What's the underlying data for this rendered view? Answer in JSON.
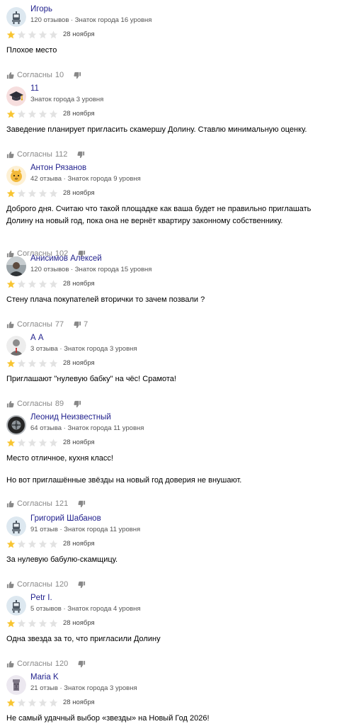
{
  "colors": {
    "star_filled": "#f8c531",
    "star_empty": "#e2e2e2",
    "author_link": "#23238e",
    "meta": "#555555",
    "reaction": "#888888"
  },
  "reviews": [
    {
      "author": "Игорь",
      "meta": "120 отзывов · Знаток города 16 уровня",
      "avatar": "robot-icon",
      "rating": 1,
      "date": "28 ноября",
      "text": [
        "Плохое место"
      ],
      "agree_label": "Согласны",
      "likes": "10",
      "dislikes": ""
    },
    {
      "author": "11",
      "meta": "Знаток города 3 уровня",
      "avatar": "graduation-cap-icon",
      "rating": 1,
      "date": "28 ноября",
      "text": [
        "Заведение планирует пригласить скамершу Долину. Ставлю минимальную оценку."
      ],
      "agree_label": "Согласны",
      "likes": "112",
      "dislikes": ""
    },
    {
      "author": "Антон Рязанов",
      "meta": "42 отзыва · Знаток города 9 уровня",
      "avatar": "cat-face-icon",
      "rating": 1,
      "date": "28 ноября",
      "text": [
        "Доброго дня. Считаю что такой площадке как ваша будет не правильно приглашать Долину на новый год, пока она не вернёт квартиру законному собственнику."
      ],
      "agree_label": "Согласны",
      "likes": "102",
      "dislikes": ""
    },
    {
      "author": "Анисимов Алексей",
      "meta": "120 отзывов · Знаток города 15 уровня",
      "avatar": "user-photo-avatar",
      "rating": 1,
      "date": "28 ноября",
      "text": [
        "Стену плача покупателей вторички то зачем позвали ?"
      ],
      "agree_label": "Согласны",
      "likes": "77",
      "dislikes": "7"
    },
    {
      "author": "А А",
      "meta": "3 отзыва · Знаток города 3 уровня",
      "avatar": "person-silhouette-icon",
      "rating": 1,
      "date": "28 ноября",
      "text": [
        "Приглашают \"нулевую бабку\" на чёс! Срамота!"
      ],
      "agree_label": "Согласны",
      "likes": "89",
      "dislikes": ""
    },
    {
      "author": "Леонид Неизвестный",
      "meta": "64 отзыва · Знаток города 11 уровня",
      "avatar": "tire-photo-avatar",
      "rating": 1,
      "date": "28 ноября",
      "text": [
        "Место отличное, кухня класс!",
        "Но вот приглашённые звёзды на новый год доверия не внушают."
      ],
      "agree_label": "Согласны",
      "likes": "121",
      "dislikes": ""
    },
    {
      "author": "Григорий Шабанов",
      "meta": "91 отзыв · Знаток города 11 уровня",
      "avatar": "robot-icon",
      "rating": 1,
      "date": "28 ноября",
      "text": [
        "За нулевую бабулю-скамщицу."
      ],
      "agree_label": "Согласны",
      "likes": "120",
      "dislikes": ""
    },
    {
      "author": "Petr I.",
      "meta": "5 отзывов · Знаток города 4 уровня",
      "avatar": "robot-icon",
      "rating": 1,
      "date": "28 ноября",
      "text": [
        "Одна звезда за то, что пригласили Долину"
      ],
      "agree_label": "Согласны",
      "likes": "120",
      "dislikes": ""
    },
    {
      "author": "Maria K",
      "meta": "21 отзыв · Знаток города 3 уровня",
      "avatar": "moai-statue-icon",
      "rating": 1,
      "date": "28 ноября",
      "text": [
        "Не самый удачный выбор «звезды» на Новый Год 2026!"
      ],
      "agree_label": "Согласны",
      "likes": "",
      "dislikes": ""
    }
  ]
}
